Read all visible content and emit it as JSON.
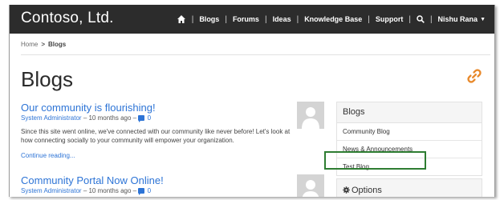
{
  "header": {
    "brand": "Contoso, Ltd.",
    "nav": [
      "Blogs",
      "Forums",
      "Ideas",
      "Knowledge Base",
      "Support"
    ],
    "user": "Nishu Rana"
  },
  "breadcrumb": {
    "home": "Home",
    "separator": ">",
    "current": "Blogs"
  },
  "page": {
    "title": "Blogs"
  },
  "posts": [
    {
      "title": "Our community is flourishing!",
      "author": "System Administrator",
      "time": "10 months ago",
      "comments": "0",
      "excerpt": "Since this site went online, we've connected with our community like never before! Let's look at how connecting socially to your community will empower your organization.",
      "read_more": "Continue reading..."
    },
    {
      "title": "Community Portal Now Online!",
      "author": "System Administrator",
      "time": "10 months ago",
      "comments": "0"
    }
  ],
  "sidebar": {
    "heading": "Blogs",
    "items": [
      "Community Blog",
      "News & Announcements",
      "Test Blog"
    ],
    "options_label": "Options"
  },
  "colors": {
    "topbar": "#2c2c2c",
    "link": "#2d74d6",
    "accent_icon": "#e8892b",
    "highlight": "#2e7d32"
  }
}
